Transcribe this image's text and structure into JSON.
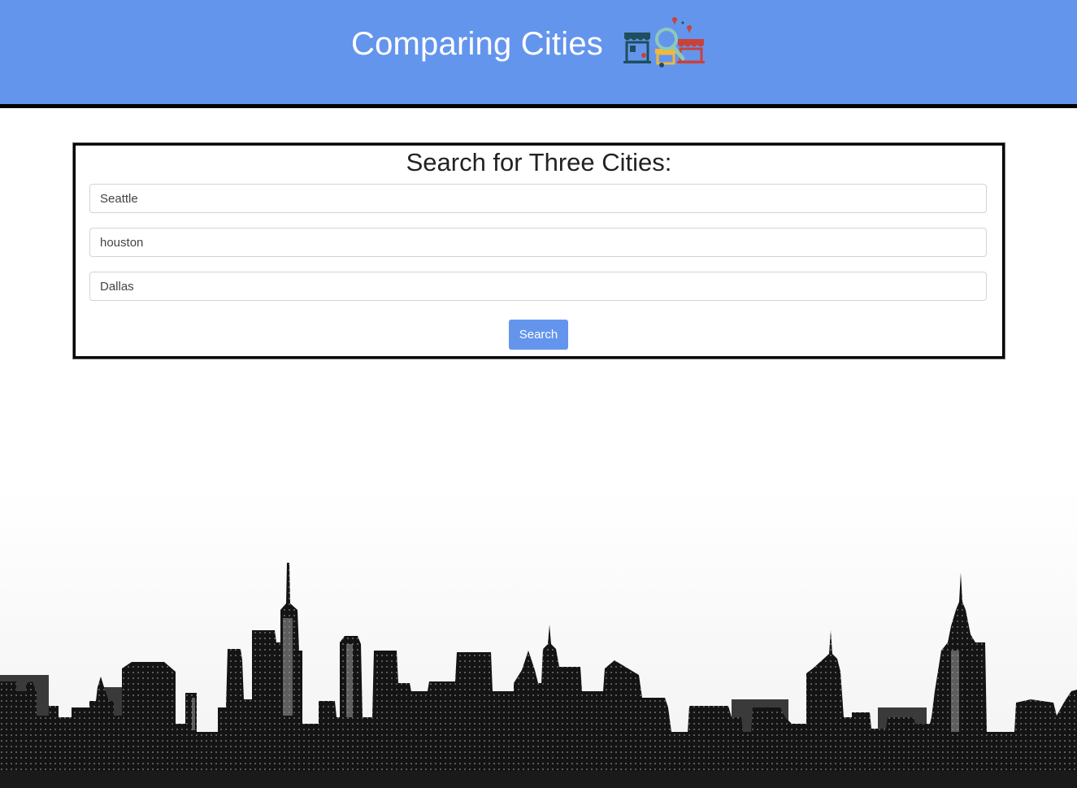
{
  "header": {
    "title": "Comparing Cities",
    "background_color": "#6495ed",
    "logo_icon": "city-shops-magnifier-icon"
  },
  "search": {
    "heading": "Search for Three Cities:",
    "inputs": [
      {
        "value": "Seattle"
      },
      {
        "value": "houston"
      },
      {
        "value": "Dallas"
      }
    ],
    "button_label": "Search",
    "button_color": "#6495ed"
  },
  "background": {
    "image": "city-skyline-silhouette"
  }
}
